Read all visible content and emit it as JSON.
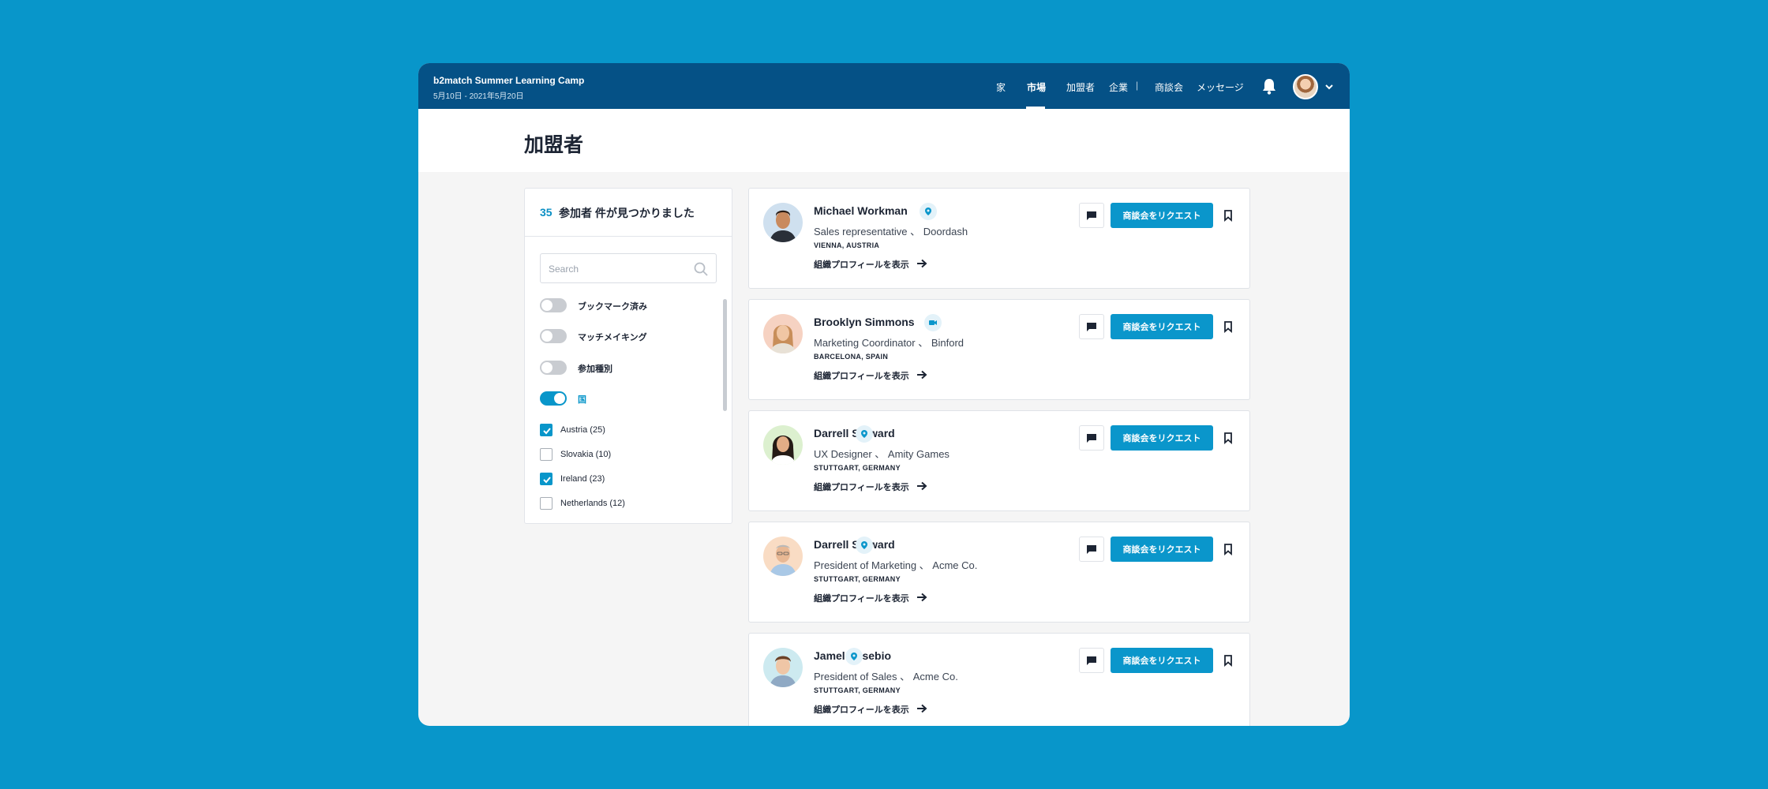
{
  "header": {
    "event_title": "b2match Summer Learning Camp",
    "event_dates": "5月10日 - 2021年5月20日",
    "nav": [
      {
        "label": "家",
        "active": false
      },
      {
        "label": "市場",
        "active": true
      },
      {
        "label": "加盟者",
        "active": false
      },
      {
        "label": "企業",
        "active": false
      },
      {
        "label": "商談会",
        "active": false
      },
      {
        "label": "メッセージ",
        "active": false
      }
    ],
    "separator": "|"
  },
  "page": {
    "title": "加盟者"
  },
  "filters": {
    "count": "35",
    "count_label": "参加者 件が見つかりました",
    "search_placeholder": "Search",
    "toggles": [
      {
        "label": "ブックマーク済み",
        "on": false
      },
      {
        "label": "マッチメイキング",
        "on": false
      },
      {
        "label": "参加種別",
        "on": false
      },
      {
        "label": "国",
        "on": true
      }
    ],
    "countries": [
      {
        "label": "Austria (25)",
        "checked": true
      },
      {
        "label": "Slovakia (10)",
        "checked": false
      },
      {
        "label": "Ireland (23)",
        "checked": true
      },
      {
        "label": "Netherlands (12)",
        "checked": false
      }
    ]
  },
  "participants": [
    {
      "name": "Michael Workman",
      "role": "Sales representative 、 Doordash",
      "location": "VIENNA, AUSTRIA",
      "meeting_icon": "location-pin-icon",
      "link": "組織プロフィールを表示",
      "request": "商談会をリクエスト"
    },
    {
      "name": "Brooklyn Simmons",
      "role": "Marketing Coordinator 、 Binford",
      "location": "BARCELONA, SPAIN",
      "meeting_icon": "video-camera-icon",
      "link": "組織プロフィールを表示",
      "request": "商談会をリクエスト"
    },
    {
      "name": "Darrell Steward",
      "role": "UX Designer 、 Amity Games",
      "location": "STUTTGART, GERMANY",
      "meeting_icon": "location-pin-icon",
      "link": "組織プロフィールを表示",
      "request": "商談会をリクエスト"
    },
    {
      "name": "Darrell Steward",
      "role": "President of Marketing 、 Acme Co.",
      "location": "STUTTGART, GERMANY",
      "meeting_icon": "location-pin-icon",
      "link": "組織プロフィールを表示",
      "request": "商談会をリクエスト"
    },
    {
      "name": "Jamel Eusebio",
      "role": "President of Sales 、 Acme Co.",
      "location": "STUTTGART, GERMANY",
      "meeting_icon": "location-pin-icon",
      "link": "組織プロフィールを表示",
      "request": "商談会をリクエスト"
    }
  ],
  "colors": {
    "background": "#0896ca",
    "topbar": "#055186",
    "accent": "#0a96cb",
    "text": "#1c2433"
  }
}
